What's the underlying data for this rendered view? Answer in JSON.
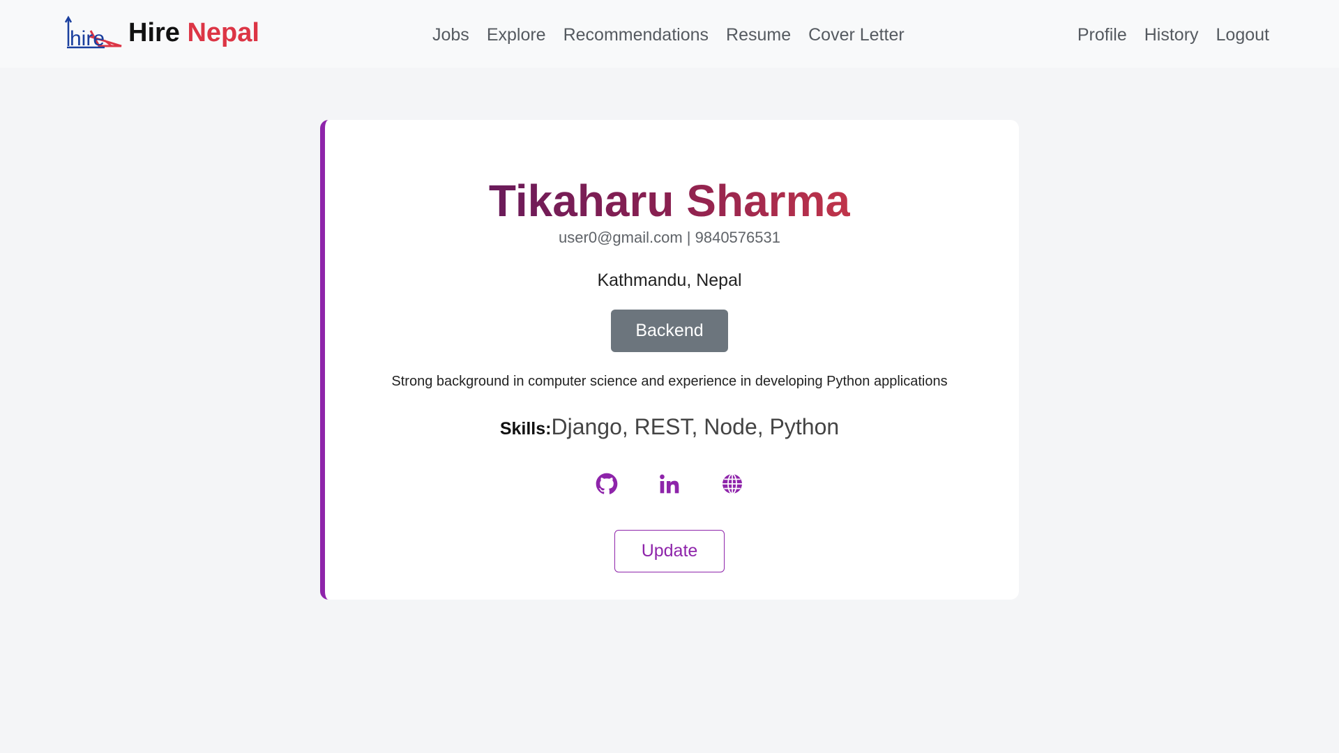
{
  "brand": {
    "logo_text": "hire",
    "name_part1": "Hire",
    "name_part2": "Nepal"
  },
  "nav": {
    "center": [
      {
        "label": "Jobs"
      },
      {
        "label": "Explore"
      },
      {
        "label": "Recommendations"
      },
      {
        "label": "Resume"
      },
      {
        "label": "Cover Letter"
      }
    ],
    "right": [
      {
        "label": "Profile"
      },
      {
        "label": "History"
      },
      {
        "label": "Logout"
      }
    ]
  },
  "profile": {
    "name": "Tikaharu Sharma",
    "email": "user0@gmail.com",
    "separator": " | ",
    "phone": "9840576531",
    "location": "Kathmandu, Nepal",
    "role": "Backend",
    "bio": "Strong background in computer science and experience in developing Python applications",
    "skills_label": "Skills:",
    "skills": "Django, REST, Node, Python",
    "links": [
      {
        "icon": "github-icon"
      },
      {
        "icon": "linkedin-icon"
      },
      {
        "icon": "globe-icon"
      }
    ],
    "update_label": "Update"
  },
  "colors": {
    "accent": "#8e24aa",
    "brand_red": "#dc3545",
    "role_badge": "#6c757d",
    "page_bg": "#f4f5f7"
  }
}
